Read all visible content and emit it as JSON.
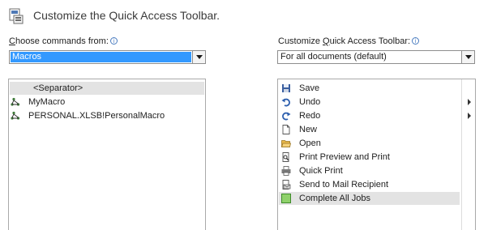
{
  "header": {
    "title": "Customize the Quick Access Toolbar."
  },
  "left": {
    "label_prefix": "C",
    "label_rest": "hoose commands from:",
    "info": "i",
    "combo_value": "Macros",
    "items": [
      {
        "label": "<Separator>",
        "icon": "separator",
        "highlight": true
      },
      {
        "label": "MyMacro",
        "icon": "macro-icon",
        "highlight": false
      },
      {
        "label": "PERSONAL.XLSB!PersonalMacro",
        "icon": "macro-icon",
        "highlight": false
      }
    ]
  },
  "right": {
    "label_pre": "Customize ",
    "label_u": "Q",
    "label_post": "uick Access Toolbar:",
    "info": "i",
    "combo_value": "For all documents (default)",
    "items": [
      {
        "label": "Save",
        "icon": "save-icon"
      },
      {
        "label": "Undo",
        "icon": "undo-icon",
        "submenu": true
      },
      {
        "label": "Redo",
        "icon": "redo-icon",
        "submenu": true
      },
      {
        "label": "New",
        "icon": "new-document-icon"
      },
      {
        "label": "Open",
        "icon": "open-folder-icon"
      },
      {
        "label": "Print Preview and Print",
        "icon": "print-preview-icon"
      },
      {
        "label": "Quick Print",
        "icon": "quick-print-icon"
      },
      {
        "label": "Send to Mail Recipient",
        "icon": "mail-recipient-icon"
      },
      {
        "label": "Complete All Jobs",
        "icon": "green-square-icon",
        "highlight": true
      }
    ]
  },
  "colors": {
    "selection": "#3399ff",
    "highlight_row": "#e3e3e3",
    "green_icon": "#8fd16b"
  }
}
